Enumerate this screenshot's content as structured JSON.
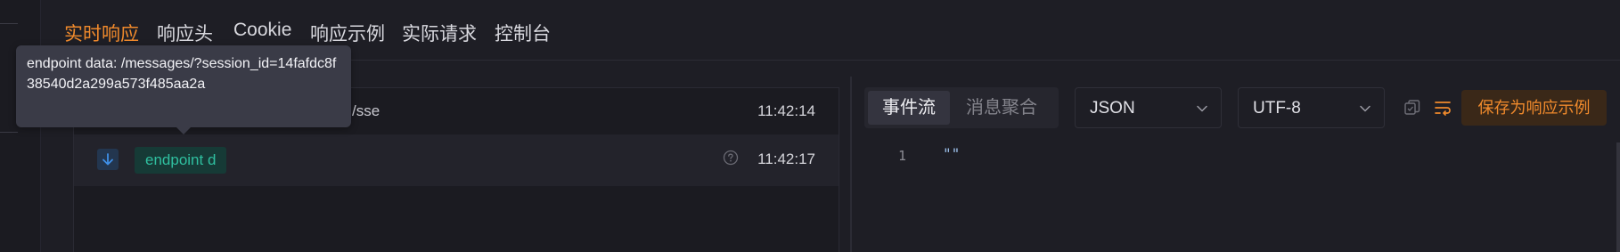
{
  "tabs": [
    {
      "label": "实时响应",
      "active": true
    },
    {
      "label": "响应头"
    },
    {
      "label": "Cookie"
    },
    {
      "label": "响应示例"
    },
    {
      "label": "实际请求"
    },
    {
      "label": "控制台"
    }
  ],
  "tooltip": {
    "text": "endpoint data: /messages/?session_id=14fafdc8f38540d2a299a573f485aa2a"
  },
  "events": [
    {
      "text": "/sse",
      "time": "11:42:14"
    },
    {
      "tag": "endpoint d",
      "time": "11:42:17",
      "icon": "arrow-down-icon",
      "help_icon": "question-circle-icon"
    }
  ],
  "view_toggle": {
    "options": [
      "事件流",
      "消息聚合"
    ],
    "selected": "事件流"
  },
  "format_select": {
    "value": "JSON"
  },
  "encoding_select": {
    "value": "UTF-8"
  },
  "toolbar": {
    "copy_icon": "copy-icon",
    "wrap_icon": "wrap-lines-icon",
    "save_label": "保存为响应示例"
  },
  "editor": {
    "lines": [
      {
        "number": "1",
        "content": "\"\""
      }
    ]
  },
  "colors": {
    "accent": "#f08a2c",
    "tag_text": "#2fbf9f",
    "background": "#1e1e25"
  }
}
